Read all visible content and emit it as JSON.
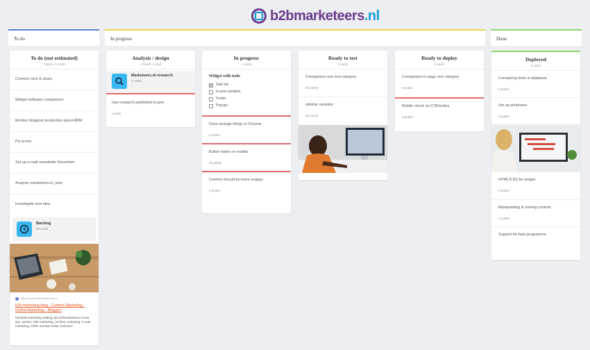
{
  "logo": {
    "part1": "b2b",
    "part2": "marketeers",
    "part3": ".nl"
  },
  "groups": {
    "todo": "To do",
    "progress": "In progress",
    "done": "Done"
  },
  "columns": {
    "todo": {
      "title": "To do (not estimated)",
      "sub": "7 items, 0 cards",
      "cards": [
        "Content, tech & share",
        "Widget software comparison",
        "Monitor blogpost production about ABM",
        "Fix errors",
        "Set up e-mail newsletter December",
        "Analyse marketeers.nl, june",
        "Investigate new idea"
      ],
      "board": {
        "title": "Backlog",
        "sub": "25 cards"
      },
      "link": {
        "url": "https://www.b2bmarketeers.nl",
        "title": "b2b marketing blog - Content Marketing - Online Marketing - Bloggen",
        "desc": "Het B2B marketing weblog van b2bmarketeers.nl met tips, opinies, b2b marketing, (online) marketing, e-mail marketing, CRM, sociaal media, business"
      }
    },
    "analysis": {
      "title": "Analysis / design",
      "sub": "1 board, 1 card",
      "board": {
        "title": "Marketeers.nl research",
        "sub": "2 cards"
      },
      "cards": [
        {
          "text": "Use research published in june",
          "pts": "1 point"
        }
      ]
    },
    "inprogress": {
      "title": "In progress",
      "sub": "4 cards",
      "list": {
        "title": "Widget with tools",
        "items": [
          {
            "label": "Side bar",
            "checked": true
          },
          {
            "label": "In-post variation",
            "checked": false
          },
          {
            "label": "Footer",
            "checked": false
          },
          {
            "label": "Popups",
            "checked": false
          }
        ]
      },
      "cards": [
        {
          "text": "Does strange things in Chrome",
          "pts": "3 points"
        },
        {
          "text": "Button fades on mobile",
          "pts": "10 points"
        },
        {
          "text": "Content should be more snappy",
          "pts": "2 points"
        }
      ]
    },
    "ready_test": {
      "title": "Ready to test",
      "sub": "2 cards",
      "cards": [
        {
          "text": "Comparison one tool category",
          "pts": "20 points"
        },
        {
          "text": "sidebar variation",
          "pts": "20 points"
        }
      ]
    },
    "ready_deploy": {
      "title": "Ready to deploy",
      "sub": "2 cards",
      "cards": [
        {
          "text": "Comparison in page one category",
          "pts": "8 points"
        },
        {
          "text": "Mobile check on CTA button",
          "pts": "3 points"
        }
      ]
    },
    "deployed": {
      "title": "Deployed",
      "sub": "5 cards",
      "cards": [
        {
          "text": "Comparing tools in database",
          "pts": "5 points"
        },
        {
          "text": "Set up wireframe",
          "pts": "8 points"
        },
        {
          "text": "HTML/CSS for widget",
          "pts": "8 points"
        },
        {
          "text": "Manipulating & moving content",
          "pts": "4 points"
        },
        {
          "text": "Support for beta programme",
          "pts": ""
        }
      ]
    }
  },
  "icons": {
    "board_analysis": "search-icon",
    "board_backlog": "clock-icon"
  },
  "colors": {
    "todo": "#5a7fd4",
    "progress": "#e6d54a",
    "done": "#8bd46a",
    "accent": "#e26a6a",
    "board_icon": "#38b6f0"
  }
}
